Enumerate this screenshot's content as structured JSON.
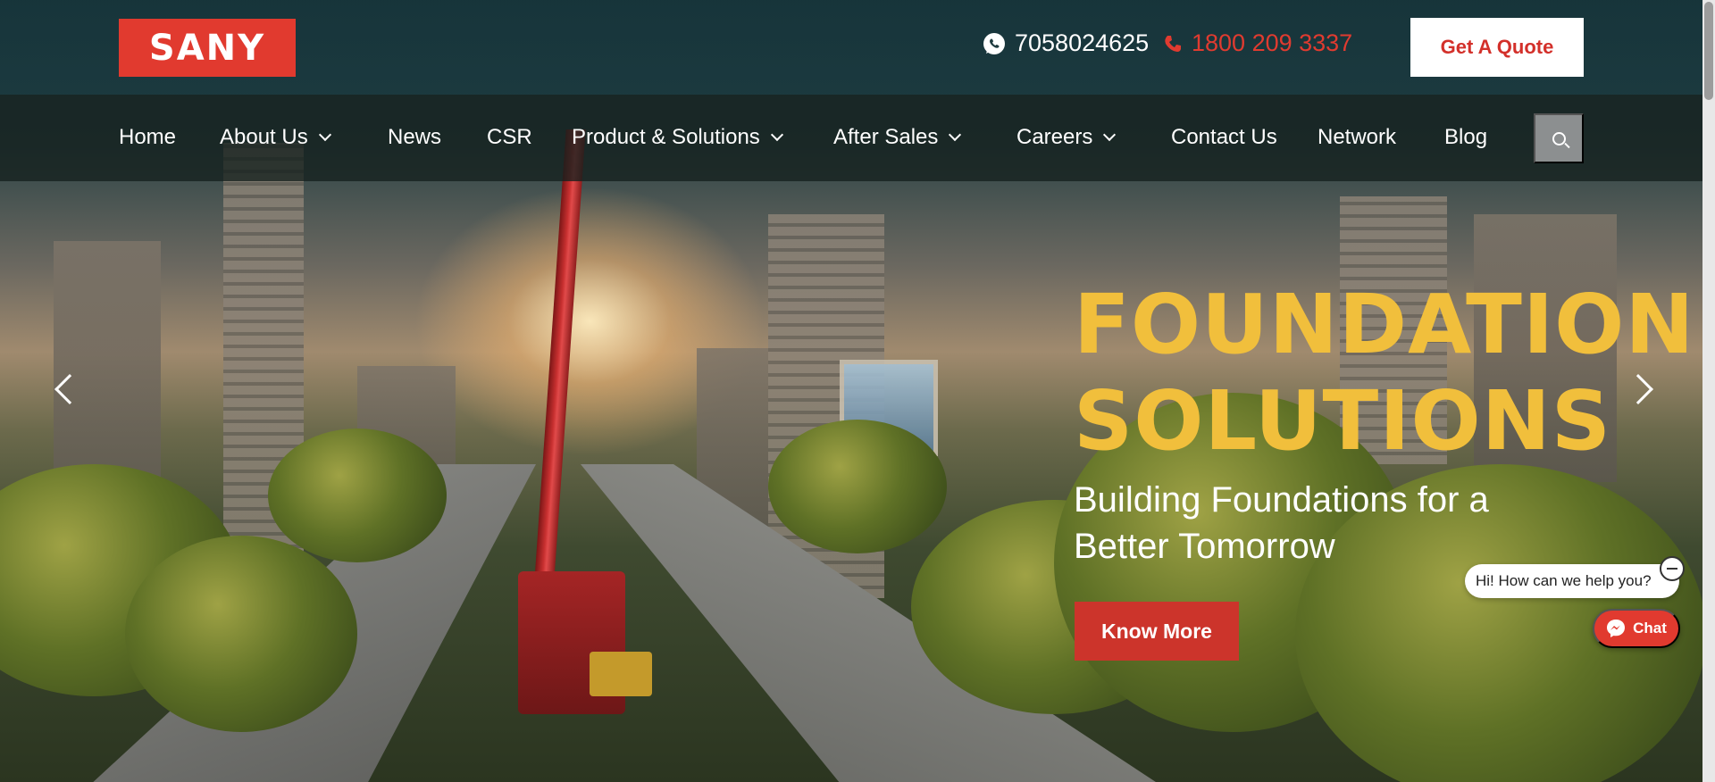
{
  "brand": {
    "logo_text": "SANY",
    "accent_color": "#e13a2f",
    "highlight_color": "#f1bf3c"
  },
  "header": {
    "whatsapp_icon": "whatsapp-icon",
    "whatsapp_number": "7058024625",
    "phone_icon": "phone-icon",
    "phone_number": "1800 209 3337",
    "quote_button": "Get A Quote"
  },
  "nav": {
    "items": [
      {
        "label": "Home"
      },
      {
        "label": "About Us",
        "dropdown": true
      },
      {
        "label": "News"
      },
      {
        "label": "CSR"
      },
      {
        "label": "Product & Solutions",
        "dropdown": true
      },
      {
        "label": "After Sales",
        "dropdown": true
      },
      {
        "label": "Careers",
        "dropdown": true
      },
      {
        "label": "Contact Us"
      },
      {
        "label": "Network"
      },
      {
        "label": "Blog"
      }
    ],
    "search_icon": "search-icon"
  },
  "hero": {
    "title_line1": "FOUNDATION",
    "title_line2": "SOLUTIONS",
    "subtitle": "Building Foundations for a Better Tomorrow",
    "cta": "Know More"
  },
  "chat": {
    "greeting": "Hi! How can we help you?",
    "button": "Chat",
    "icon": "messenger-icon"
  }
}
